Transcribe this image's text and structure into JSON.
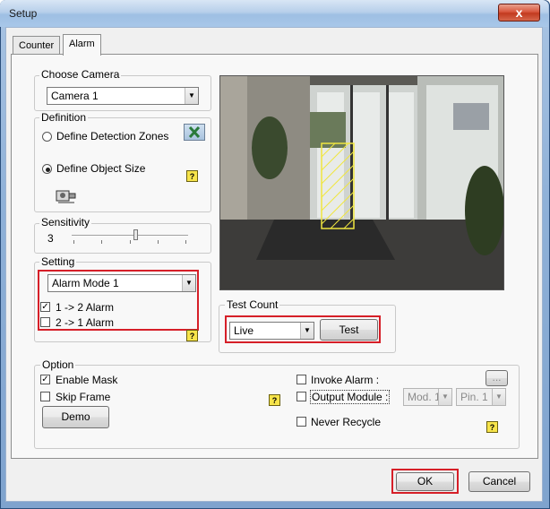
{
  "window": {
    "title": "Setup",
    "close_glyph": "x"
  },
  "tabs": [
    {
      "label": "Counter"
    },
    {
      "label": "Alarm"
    }
  ],
  "choose_camera": {
    "label": "Choose Camera",
    "value": "Camera 1"
  },
  "definition": {
    "label": "Definition",
    "zones_label": "Define Detection Zones",
    "size_label": "Define Object Size",
    "selected": "Define Object Size"
  },
  "sensitivity": {
    "label": "Sensitivity",
    "value": "3",
    "level": 0.55
  },
  "setting": {
    "label": "Setting",
    "mode": "Alarm Mode 1",
    "opt1_label": "1 -> 2 Alarm",
    "opt1_checked": true,
    "opt2_label": "2 -> 1 Alarm",
    "opt2_checked": false
  },
  "test_count": {
    "label": "Test Count",
    "value": "Live",
    "test_button": "Test"
  },
  "option": {
    "label": "Option",
    "enable_mask": "Enable Mask",
    "enable_mask_checked": true,
    "skip_frame": "Skip Frame",
    "skip_frame_checked": false,
    "demo_button": "Demo",
    "invoke_alarm": "Invoke Alarm :",
    "browse_button": "...",
    "output_module": "Output Module :",
    "module_value": "Mod. 1",
    "pin_value": "Pin. 1",
    "never_recycle": "Never Recycle"
  },
  "footer": {
    "ok": "OK",
    "cancel": "Cancel"
  },
  "help_glyph": "?",
  "colors": {
    "highlight": "#d61f28",
    "zone": "#f0e640"
  }
}
